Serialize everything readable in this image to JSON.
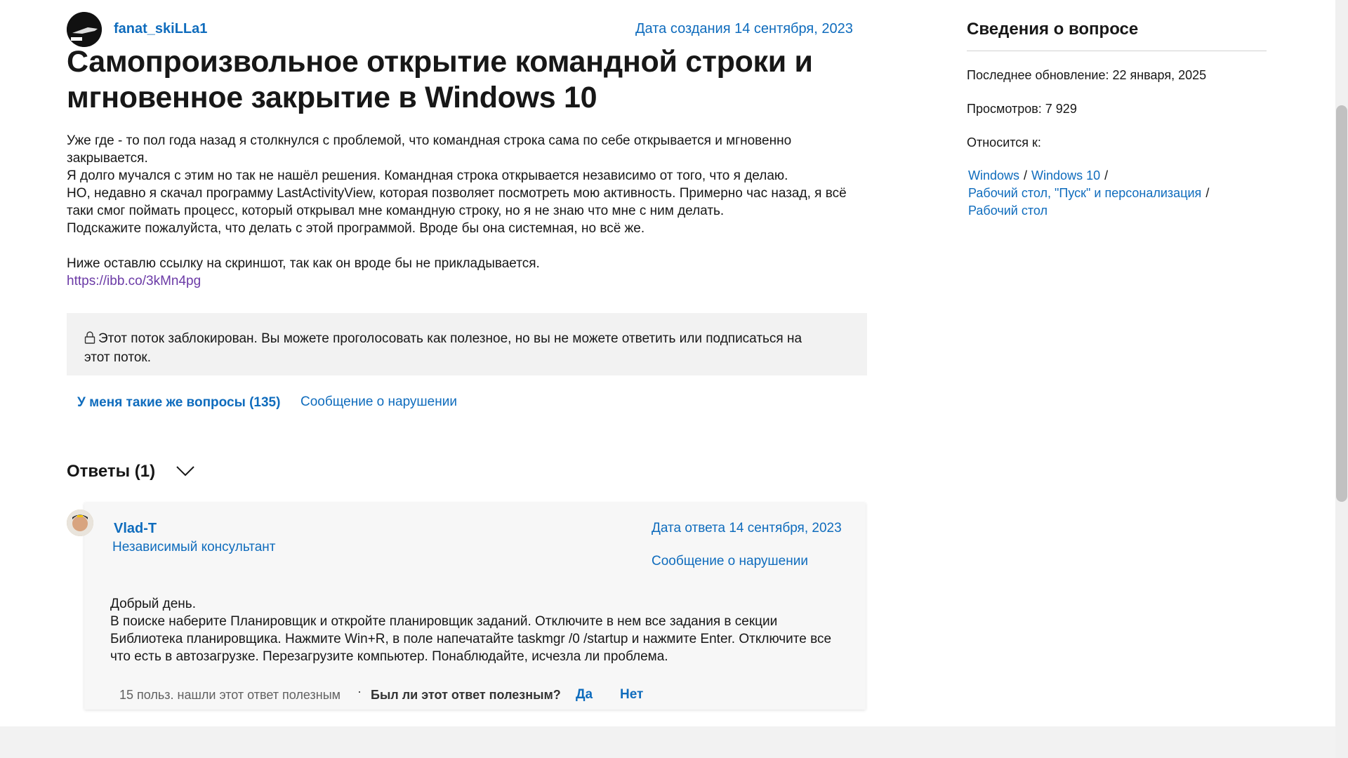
{
  "question": {
    "author": "fanat_skiLLa1",
    "created": "Дата создания 14 сентября, 2023",
    "title": "Самопроизвольное открытие командной строки и мгновенное закрытие в Windows 10",
    "body": [
      "Уже где - то пол года назад я столкнулся с проблемой, что командная строка сама по себе открывается и мгновенно закрывается.",
      "Я долго мучался с этим но так не нашёл решения. Командная строка открывается независимо от того, что я делаю.",
      "НО, недавно я скачал программу LastActivityView, которая позволяет посмотреть мою активность. Примерно час назад, я всё таки смог поймать процесс, который открывал мне командную строку, но я не знаю что мне с ним делать.",
      "Подскажите пожалуйста, что делать с этой программой. Вроде бы она системная, но всё же.",
      "Ниже оставлю ссылку на скриншот, так как он вроде бы не прикладывается."
    ],
    "link": "https://ibb.co/3kMn4pg",
    "locked_notice": "Этот поток заблокирован. Вы можете проголосовать как полезное, но вы не можете ответить или подписаться на этот поток.",
    "same_question": "У меня такие же вопросы (135)",
    "report": "Сообщение о нарушении"
  },
  "answers": {
    "header": "Ответы (1)",
    "items": [
      {
        "author": "Vlad-T",
        "role": "Независимый консультант",
        "date": "Дата ответа 14 сентября, 2023",
        "report": "Сообщение о нарушении",
        "body": [
          "Добрый день.",
          "В поиске наберите Планировщик и откройте планировщик заданий. Отключите в нем все задания в секции Библиотека планировщика. Нажмите Win+R, в поле напечатайте taskmgr /0 /startup и нажмите Enter. Отключите все что есть в автозагрузке. Перезагрузите компьютер. Понаблюдайте, исчезла ли проблема."
        ],
        "helpful_count": "15 польз. нашли этот ответ полезным",
        "helpful_question": "Был ли этот ответ полезным?",
        "yes": "Да",
        "no": "Нет"
      }
    ]
  },
  "sidebar": {
    "title": "Сведения о вопросе",
    "updated": "Последнее обновление: 22 января, 2025",
    "views": "Просмотров: 7 929",
    "relates": "Относится к:",
    "crumbs": [
      "Windows",
      "Windows 10",
      "Рабочий стол, \"Пуск\" и персонализация",
      "Рабочий стол"
    ],
    "separator": "/"
  },
  "colors": {
    "link": "#0f6cbd",
    "visited_link": "#6b3aa6",
    "notice_bg": "#f2f2f2"
  },
  "icons": {
    "lock": "lock-icon",
    "chevron": "chevron-down-icon"
  }
}
